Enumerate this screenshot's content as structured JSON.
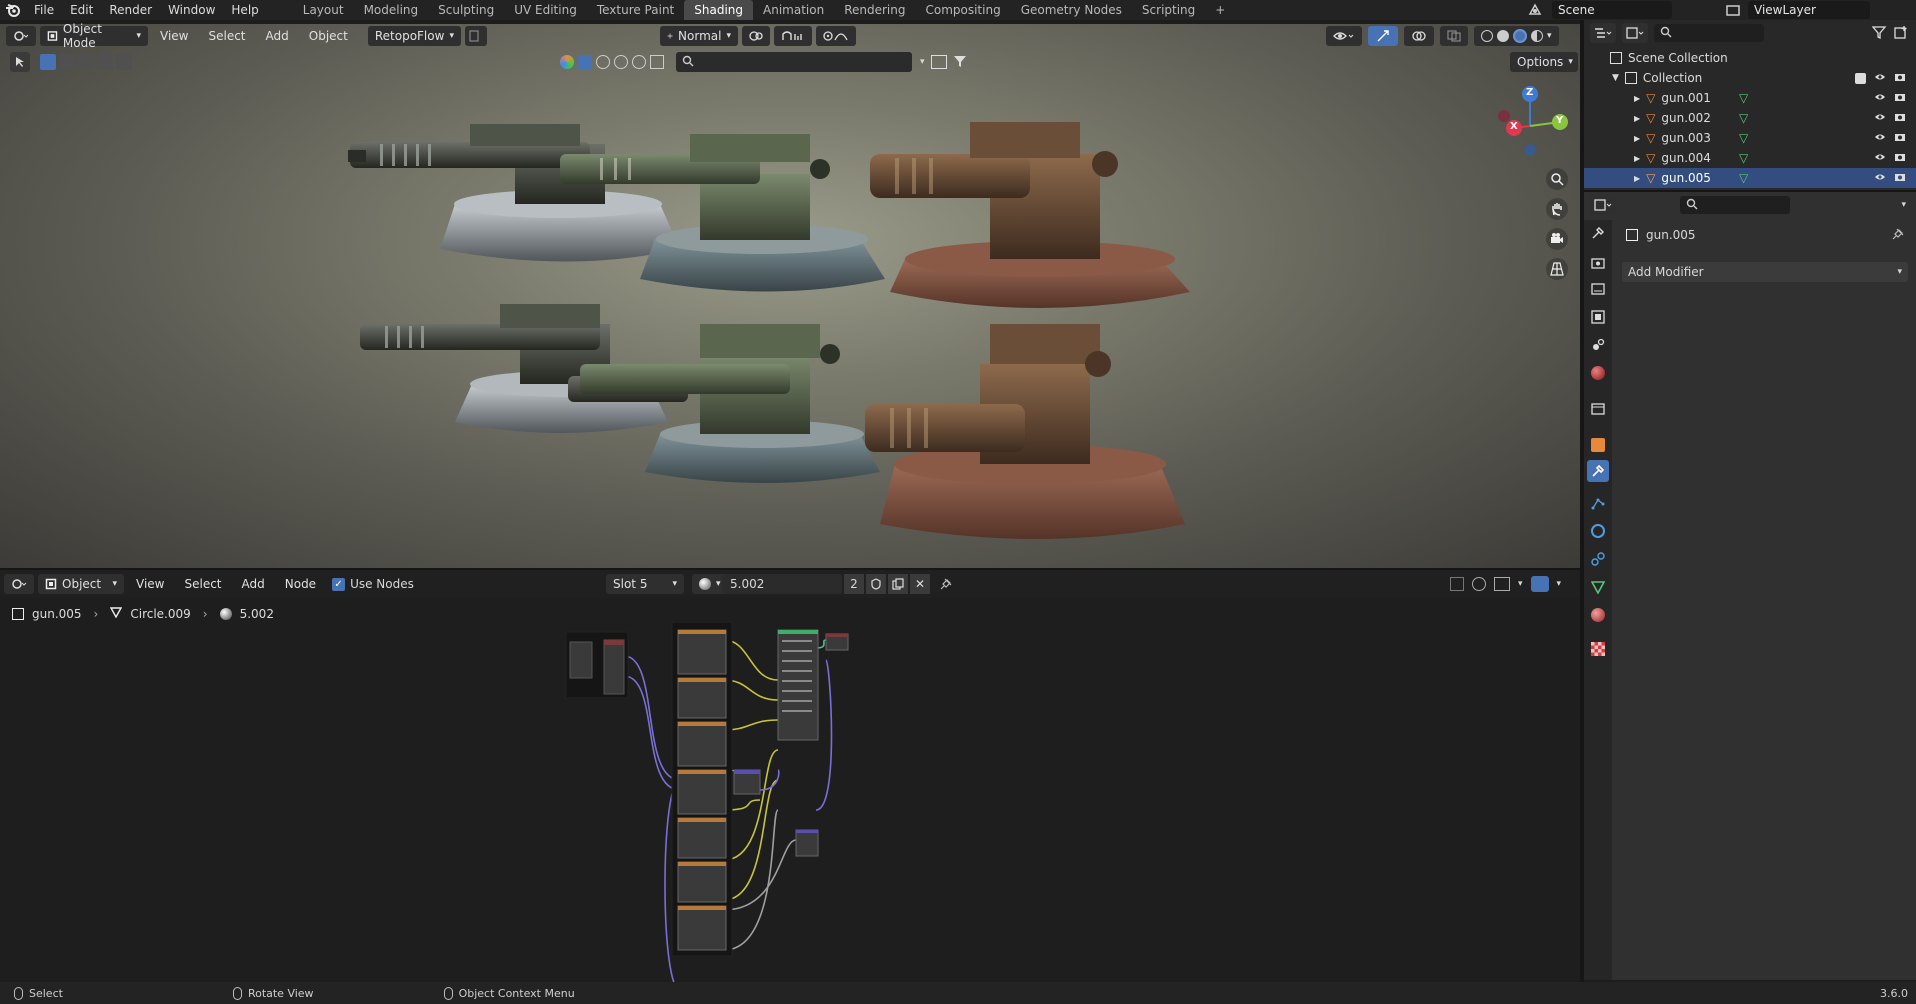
{
  "menu": {
    "file": "File",
    "edit": "Edit",
    "render": "Render",
    "window": "Window",
    "help": "Help"
  },
  "workspaces": [
    "Layout",
    "Modeling",
    "Sculpting",
    "UV Editing",
    "Texture Paint",
    "Shading",
    "Animation",
    "Rendering",
    "Compositing",
    "Geometry Nodes",
    "Scripting"
  ],
  "active_workspace": "Shading",
  "scene": {
    "name": "Scene",
    "view_layer": "ViewLayer"
  },
  "viewport_header": {
    "mode": "Object Mode",
    "view": "View",
    "select": "Select",
    "add": "Add",
    "object": "Object",
    "addon": "RetopoFlow",
    "orientation": "Normal",
    "options": "Options"
  },
  "gizmo": {
    "x": "X",
    "y": "Y",
    "z": "Z"
  },
  "node_editor_header": {
    "type": "Object",
    "view": "View",
    "select": "Select",
    "add": "Add",
    "node": "Node",
    "use_nodes": "Use Nodes",
    "slot": "Slot 5",
    "material": "5.002",
    "users": "2"
  },
  "breadcrumbs": {
    "object": "gun.005",
    "mesh": "Circle.009",
    "material": "5.002"
  },
  "outliner": {
    "scene_collection": "Scene Collection",
    "collection": "Collection",
    "items": [
      "gun.001",
      "gun.002",
      "gun.003",
      "gun.004",
      "gun.005"
    ]
  },
  "properties": {
    "object_name": "gun.005",
    "add_modifier": "Add Modifier"
  },
  "statusbar": {
    "select": "Select",
    "rotate": "Rotate View",
    "context": "Object Context Menu",
    "version": "3.6.0"
  },
  "colors": {
    "accent": "#4772b3",
    "active_tab": "#4a4a4a",
    "x_axis": "#e2374f",
    "y_axis": "#8bc43f",
    "z_axis": "#3f7bd6"
  }
}
